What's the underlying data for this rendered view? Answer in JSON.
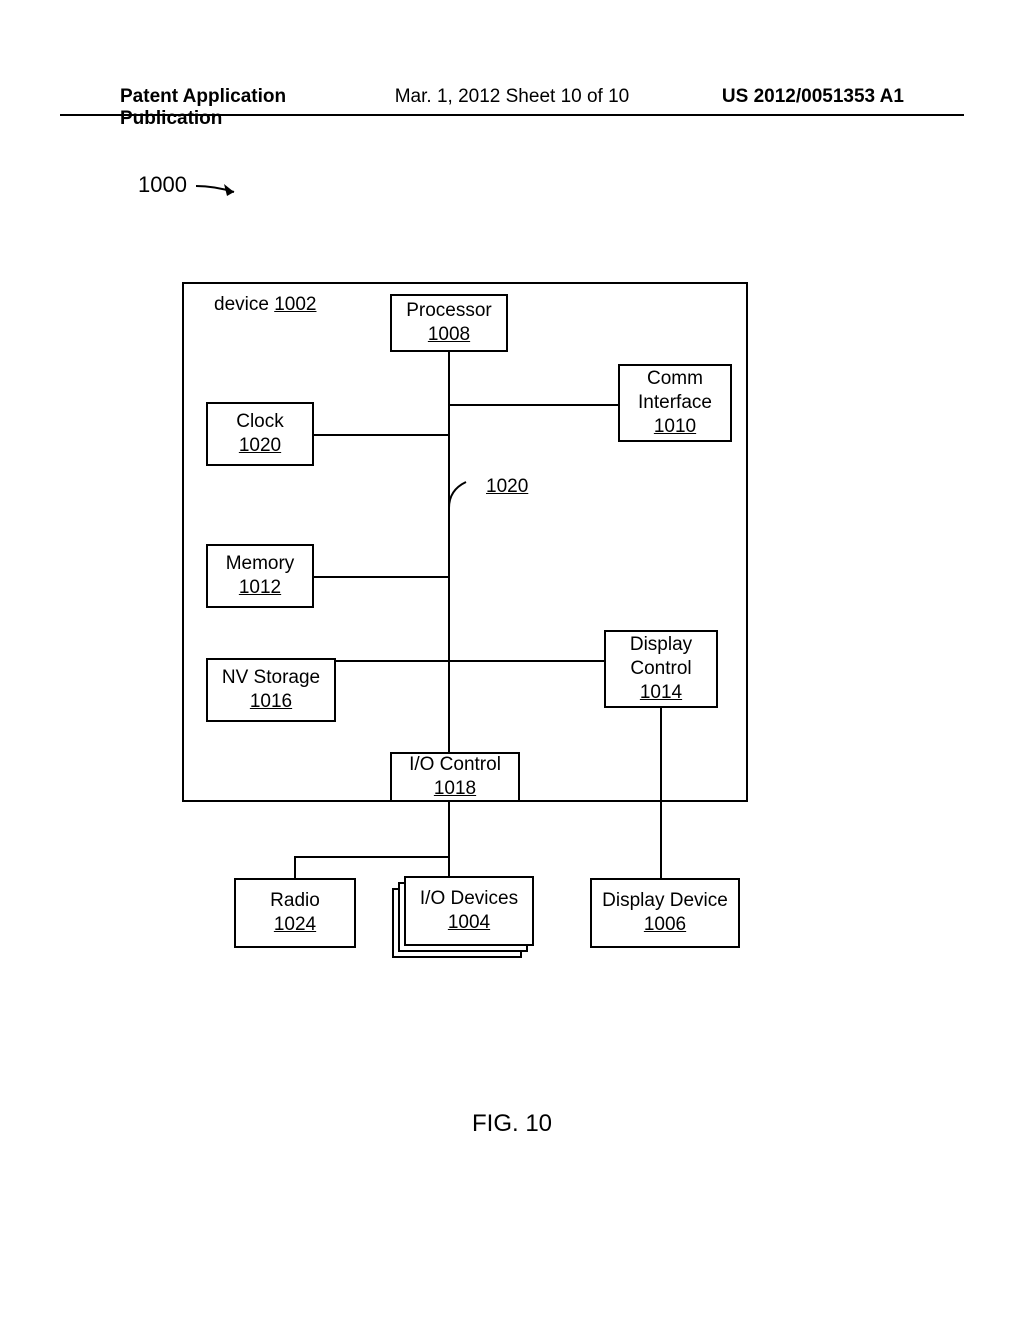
{
  "header": {
    "left": "Patent Application Publication",
    "mid": "Mar. 1, 2012  Sheet 10 of 10",
    "right": "US 2012/0051353 A1"
  },
  "figure_ref": "1000",
  "device": {
    "label_text": "device",
    "label_num": "1002"
  },
  "blocks": {
    "processor": {
      "name": "Processor",
      "num": "1008"
    },
    "comm": {
      "name": "Comm Interface",
      "num": "1010"
    },
    "clock": {
      "name": "Clock",
      "num": "1020"
    },
    "memory": {
      "name": "Memory",
      "num": "1012"
    },
    "nvstorage": {
      "name": "NV Storage",
      "num": "1016"
    },
    "displayctrl": {
      "name": "Display Control",
      "num": "1014"
    },
    "iocontrol": {
      "name": "I/O Control",
      "num": "1018"
    },
    "radio": {
      "name": "Radio",
      "num": "1024"
    },
    "iodevices": {
      "name": "I/O Devices",
      "num": "1004"
    },
    "displaydev": {
      "name": "Display Device",
      "num": "1006"
    }
  },
  "bus_label": "1020",
  "caption": "FIG. 10"
}
